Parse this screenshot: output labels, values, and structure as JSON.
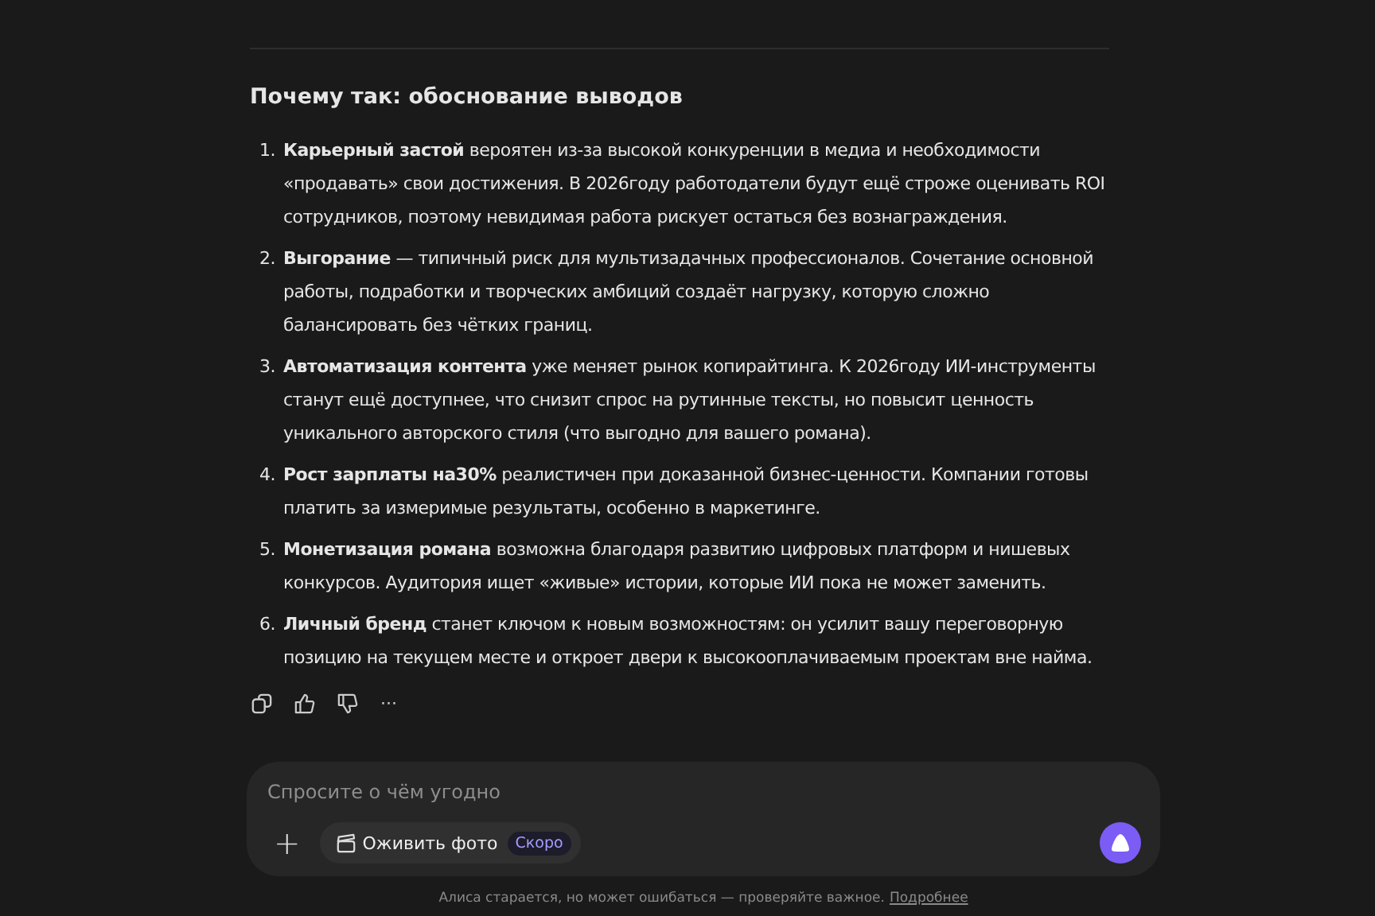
{
  "section": {
    "heading": "Почему так: обоснование выводов",
    "items": [
      {
        "number": "1.",
        "text": "**Карьерный застой** вероятен из-за высокой конкуренции в медиа и необходимости «продавать» свои достижения. В 2026году работодатели будут ещё строже оценивать ROI сотрудников, поэтому невидимая работа рискует остаться без вознаграждения."
      },
      {
        "number": "2.",
        "text": "**Выгорание** — типичный риск для мультизадачных профессионалов. Сочетание основной работы, подработки и творческих амбиций создаёт нагрузку, которую сложно балансировать без чётких границ."
      },
      {
        "number": "3.",
        "text": "**Автоматизация контента** уже меняет рынок копирайтинга. К 2026году ИИ-инструменты станут ещё доступнее, что снизит спрос на рутинные тексты, но повысит ценность уникального авторского стиля (что выгодно для вашего романа)."
      },
      {
        "number": "4.",
        "text": "**Рост зарплаты на30%** реалистичен при доказанной бизнес-ценности. Компании готовы платить за измеримые результаты, особенно в маркетинге."
      },
      {
        "number": "5.",
        "text": "**Монетизация романа** возможна благодаря развитию цифровых платформ и нишевых конкурсов. Аудитория ищет «живые» истории, которые ИИ пока не может заменить."
      },
      {
        "number": "6.",
        "text": "**Личный бренд** станет ключом к новым возможностям: он усилит вашу переговорную позицию на текущем месте и откроет двери к высокооплачиваемым проектам вне найма."
      }
    ],
    "actions": [
      {
        "kind": "copy"
      },
      {
        "kind": "like"
      },
      {
        "kind": "dislike"
      },
      {
        "kind": "more",
        "label": "···"
      }
    ]
  },
  "composer": {
    "placeholder": "Спросите о чём угодно",
    "add_label": "+",
    "photo_button": "Оживить фото",
    "badge": "Скоро"
  },
  "footer": {
    "text": "Алиса старается, но может ошибаться — проверяйте важное.",
    "link": "Подробнее"
  }
}
